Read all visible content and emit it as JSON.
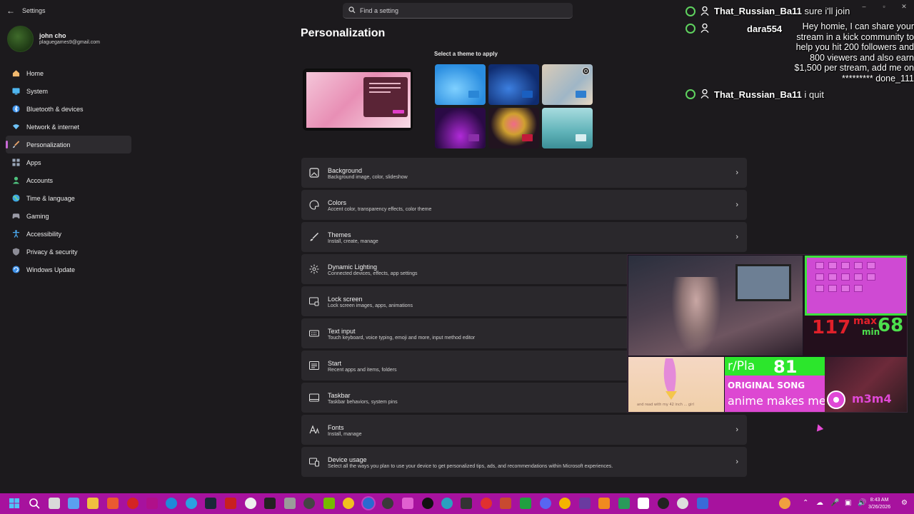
{
  "app": {
    "title": "Settings",
    "search_placeholder": "Find a setting",
    "window_controls": [
      "–",
      "▫",
      "✕"
    ]
  },
  "profile": {
    "name": "john cho",
    "email": "plaguegames9@gmail.com"
  },
  "sidebar": {
    "items": [
      {
        "label": "Home",
        "icon": "home-icon",
        "color": "#f0b86e"
      },
      {
        "label": "System",
        "icon": "system-icon",
        "color": "#4fb6f0"
      },
      {
        "label": "Bluetooth & devices",
        "icon": "bluetooth-icon",
        "color": "#3a8fe8"
      },
      {
        "label": "Network & internet",
        "icon": "wifi-icon",
        "color": "#6ec1f5"
      },
      {
        "label": "Personalization",
        "icon": "brush-icon",
        "color": "#e6a36b",
        "active": true
      },
      {
        "label": "Apps",
        "icon": "apps-icon",
        "color": "#9aa6b8"
      },
      {
        "label": "Accounts",
        "icon": "accounts-icon",
        "color": "#4ec27e"
      },
      {
        "label": "Time & language",
        "icon": "globe-icon",
        "color": "#3fa6e0"
      },
      {
        "label": "Gaming",
        "icon": "gaming-icon",
        "color": "#9a9aa6"
      },
      {
        "label": "Accessibility",
        "icon": "accessibility-icon",
        "color": "#4aa7ec"
      },
      {
        "label": "Privacy & security",
        "icon": "shield-icon",
        "color": "#8c8c96"
      },
      {
        "label": "Windows Update",
        "icon": "update-icon",
        "color": "#3b8ee6"
      }
    ]
  },
  "main": {
    "title": "Personalization",
    "theme_caption": "Select a theme to apply",
    "themes": [
      {
        "name": "windows-light",
        "bg": "#3aa0ea",
        "chip": "#2a86d6"
      },
      {
        "name": "windows-dark",
        "bg": "#1d4fa8",
        "chip": "#1a5fc0"
      },
      {
        "name": "glow",
        "bg": "#bfb3a6",
        "chip": "#2f7fd0"
      },
      {
        "name": "captured-motion",
        "bg": "#4a1a6e",
        "chip": "#8a2fa8"
      },
      {
        "name": "flow",
        "bg": "#221420",
        "chip": "#c21a3a"
      },
      {
        "name": "sunrise",
        "bg": "#7cc3c6",
        "chip": "#d8eef0"
      }
    ],
    "settings": [
      {
        "title": "Background",
        "desc": "Background image, color, slideshow",
        "icon": "image-icon"
      },
      {
        "title": "Colors",
        "desc": "Accent color, transparency effects, color theme",
        "icon": "palette-icon"
      },
      {
        "title": "Themes",
        "desc": "Install, create, manage",
        "icon": "brush-icon"
      },
      {
        "title": "Dynamic Lighting",
        "desc": "Connected devices, effects, app settings",
        "icon": "lighting-icon"
      },
      {
        "title": "Lock screen",
        "desc": "Lock screen images, apps, animations",
        "icon": "lock-screen-icon"
      },
      {
        "title": "Text input",
        "desc": "Touch keyboard, voice typing, emoji and more, input method editor",
        "icon": "keyboard-icon"
      },
      {
        "title": "Start",
        "desc": "Recent apps and items, folders",
        "icon": "start-icon"
      },
      {
        "title": "Taskbar",
        "desc": "Taskbar behaviors, system pins",
        "icon": "taskbar-icon"
      },
      {
        "title": "Fonts",
        "desc": "Install, manage",
        "icon": "fonts-icon"
      },
      {
        "title": "Device usage",
        "desc": "Select all the ways you plan to use your device to get personalized tips, ads, and recommendations within Microsoft experiences.",
        "icon": "device-usage-icon"
      }
    ]
  },
  "chat": {
    "messages": [
      {
        "user": "That_Russian_Ba11",
        "text": "sure i'll join"
      },
      {
        "user": "dara554",
        "text": "Hey homie, I can share your stream in a kick community to help you hit 200 followers and 800 viewers and also earn $1,500 per stream, add me on ********* done_111"
      },
      {
        "user": "That_Russian_Ba11",
        "text": "i quit"
      }
    ]
  },
  "stream_overlay": {
    "stat_big": "117",
    "stat_max": "max",
    "stat_min": "min",
    "stat_small": "68",
    "reddit_tag": "r/Pla",
    "count": "81",
    "original_song": "ORIGINAL SONG",
    "song_title": "anime makes me",
    "handle": "m3m4",
    "caption": "and read with my 42 inch ... girl"
  },
  "taskbar": {
    "clock_time": "8:43 AM",
    "clock_date": "3/26/2026"
  }
}
